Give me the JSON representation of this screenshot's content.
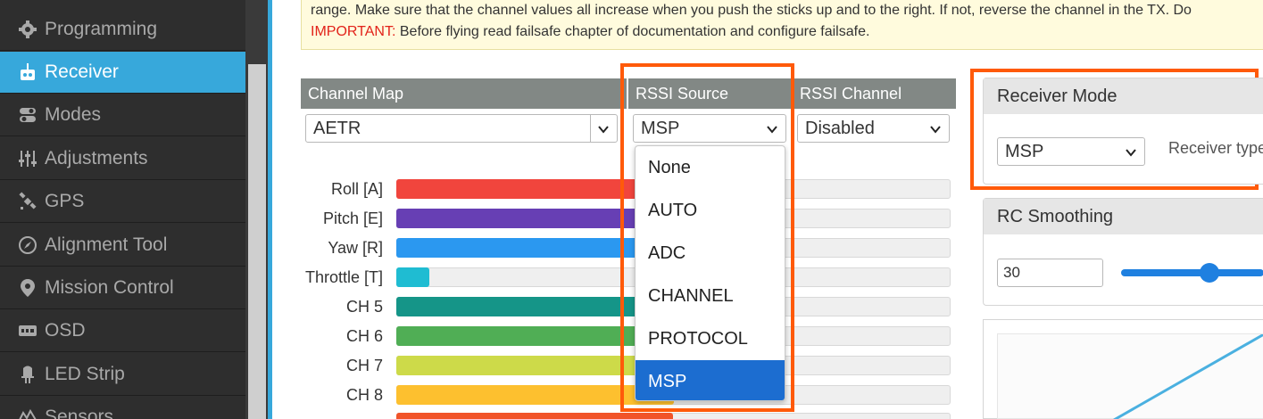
{
  "sidebar": {
    "items": [
      {
        "label": "Programming",
        "icon": "gear-icon",
        "active": false
      },
      {
        "label": "Receiver",
        "icon": "receiver-icon",
        "active": true
      },
      {
        "label": "Modes",
        "icon": "toggle-icon",
        "active": false
      },
      {
        "label": "Adjustments",
        "icon": "sliders-icon",
        "active": false
      },
      {
        "label": "GPS",
        "icon": "satellite-icon",
        "active": false
      },
      {
        "label": "Alignment Tool",
        "icon": "compass-icon",
        "active": false
      },
      {
        "label": "Mission Control",
        "icon": "map-pin-icon",
        "active": false
      },
      {
        "label": "OSD",
        "icon": "osd-icon",
        "active": false
      },
      {
        "label": "LED Strip",
        "icon": "led-icon",
        "active": false
      },
      {
        "label": "Sensors",
        "icon": "sensor-icon",
        "active": false
      }
    ]
  },
  "note": {
    "line1_prefix": "",
    "line1": "range. Make sure that the channel values all increase when you push the sticks up and to the right. If not, reverse the channel in the TX. Do",
    "important_label": "IMPORTANT:",
    "line2": "Before flying read failsafe chapter of documentation and configure failsafe."
  },
  "channel_map": {
    "header": "Channel Map",
    "value": "AETR"
  },
  "rssi_source": {
    "header": "RSSI Source",
    "value": "MSP",
    "options": [
      "None",
      "AUTO",
      "ADC",
      "CHANNEL",
      "PROTOCOL",
      "MSP"
    ],
    "selected_index": 5
  },
  "rssi_channel": {
    "header": "RSSI Channel",
    "value": "Disabled"
  },
  "channels": [
    {
      "label": "Roll [A]",
      "color": "#f1453d",
      "fill_fraction": 0.5
    },
    {
      "label": "Pitch [E]",
      "color": "#673fb4",
      "fill_fraction": 0.5
    },
    {
      "label": "Yaw [R]",
      "color": "#2b98f0",
      "fill_fraction": 0.5
    },
    {
      "label": "Throttle [T]",
      "color": "#1fbcd2",
      "fill_fraction": 0.06
    },
    {
      "label": "CH 5",
      "color": "#159588",
      "fill_fraction": 0.5
    },
    {
      "label": "CH 6",
      "color": "#50ae55",
      "fill_fraction": 0.5
    },
    {
      "label": "CH 7",
      "color": "#cdda49",
      "fill_fraction": 0.5
    },
    {
      "label": "CH 8",
      "color": "#fdc02f",
      "fill_fraction": 0.5
    }
  ],
  "receiver_mode": {
    "header": "Receiver Mode",
    "value": "MSP",
    "type_label": "Receiver type"
  },
  "rc_smoothing": {
    "header": "RC Smoothing",
    "value": "30",
    "slider_fraction": 0.62
  },
  "colors": {
    "accent": "#37a8db",
    "highlight": "#ff5a0a",
    "dropdown_selected": "#1c6dd0"
  }
}
